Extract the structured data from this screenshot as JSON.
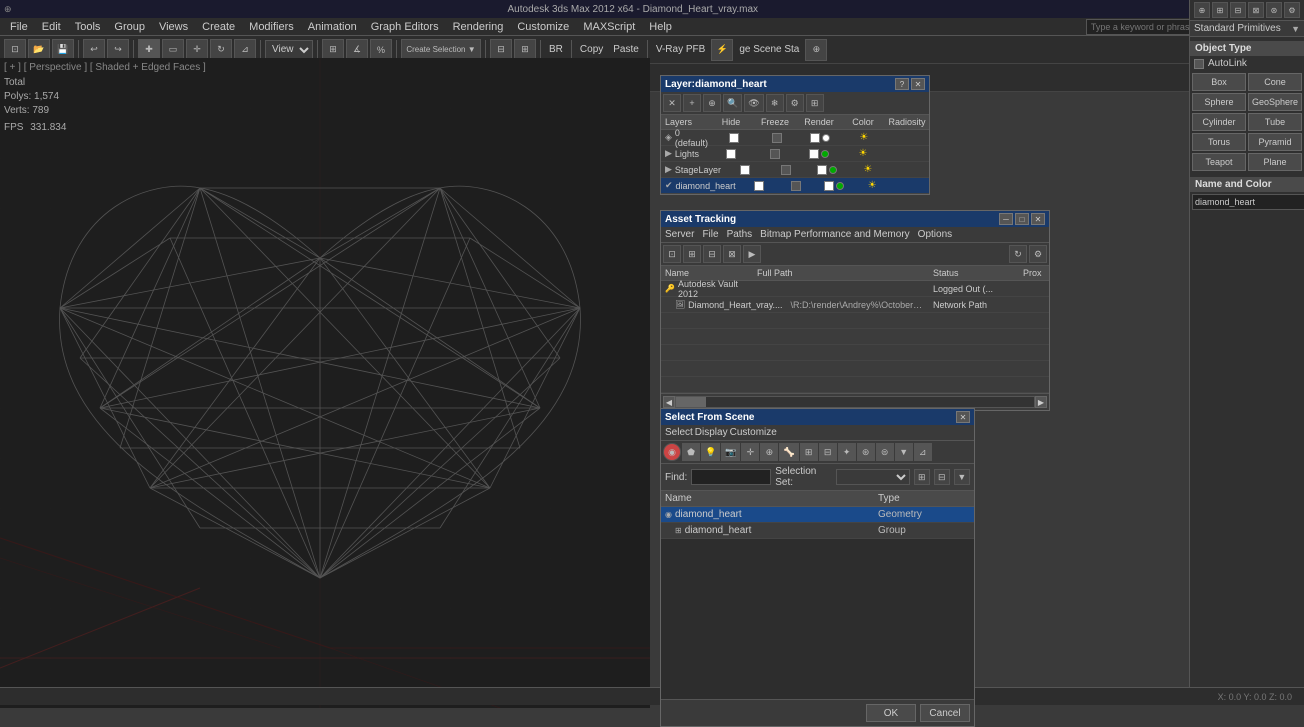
{
  "app": {
    "title": "Autodesk 3ds Max 2012 x64 - Diamond_Heart_vray.max",
    "search_placeholder": "Type a keyword or phrase"
  },
  "menu": {
    "items": [
      "File",
      "Edit",
      "Tools",
      "Group",
      "Views",
      "Create",
      "Modifiers",
      "Animation",
      "Graph Editors",
      "Rendering",
      "Customize",
      "MAXScript",
      "Help"
    ]
  },
  "viewport": {
    "label": "[ + ] [ Perspective ] [ Shaded + Edged Faces ]",
    "stats": {
      "total_label": "Total",
      "polys_label": "Polys:",
      "polys_value": "1,574",
      "verts_label": "Verts:",
      "verts_value": "789",
      "fps_label": "FPS",
      "fps_value": "331.834"
    }
  },
  "layer_dialog": {
    "title": "Layer:diamond_heart",
    "columns": [
      "Layers",
      "Hide",
      "Freeze",
      "Render",
      "Color",
      "Radiosity"
    ],
    "rows": [
      {
        "name": "0 (default)",
        "hide": true,
        "freeze": false,
        "render": true,
        "color": "#ffffff"
      },
      {
        "name": "Lights",
        "hide": true,
        "freeze": false,
        "render": true,
        "color": "#00aa00"
      },
      {
        "name": "StageLayer",
        "hide": true,
        "freeze": false,
        "render": true,
        "color": "#00aa00"
      },
      {
        "name": "diamond_heart",
        "hide": true,
        "freeze": false,
        "render": true,
        "color": "#00aa00"
      }
    ]
  },
  "asset_dialog": {
    "title": "Asset Tracking",
    "menu_items": [
      "Server",
      "File",
      "Paths",
      "Bitmap Performance and Memory",
      "Options"
    ],
    "columns": [
      "Name",
      "Full Path",
      "Status",
      "Prox"
    ],
    "rows": [
      {
        "name": "Autodesk Vault 2012",
        "full_path": "",
        "status": "Logged Out (...",
        "prox": ""
      },
      {
        "name": "Diamond_Heart_vray....",
        "full_path": "\\R:D:\\render\\Andrey%\\October_2017\\Diamon...",
        "status": "Network Path",
        "prox": ""
      }
    ]
  },
  "select_dialog": {
    "title": "Select From Scene",
    "menu_items": [
      "Select",
      "Display",
      "Customize"
    ],
    "find_label": "Find:",
    "find_placeholder": "",
    "selection_set_label": "Selection Set:",
    "columns": [
      "Name",
      "Type"
    ],
    "rows": [
      {
        "name": "diamond_heart",
        "type": "Geometry",
        "selected": true,
        "icon_color": "#888"
      },
      {
        "name": "diamond_heart",
        "type": "Group",
        "selected": false,
        "icon_color": "#888"
      }
    ],
    "buttons": [
      "OK",
      "Cancel"
    ]
  },
  "right_panel": {
    "title": "Standard Primitives",
    "object_type": "Object Type",
    "autolink_label": "AutoLink",
    "primitives": [
      "Box",
      "Cone",
      "Sphere",
      "GeoSphere",
      "Cylinder",
      "Tube",
      "Torus",
      "Pyramid",
      "Teapot",
      "Plane"
    ],
    "name_color_title": "Name and Color",
    "name_value": "diamond_heart",
    "color_hex": "#2244aa"
  },
  "status_bar": {
    "text": ""
  },
  "vray_pfb_label": "V-Ray PFB",
  "br_label": "BR",
  "copy_label": "Copy",
  "paste_label": "Paste",
  "ge_scene_label": "ge Scene Sta"
}
